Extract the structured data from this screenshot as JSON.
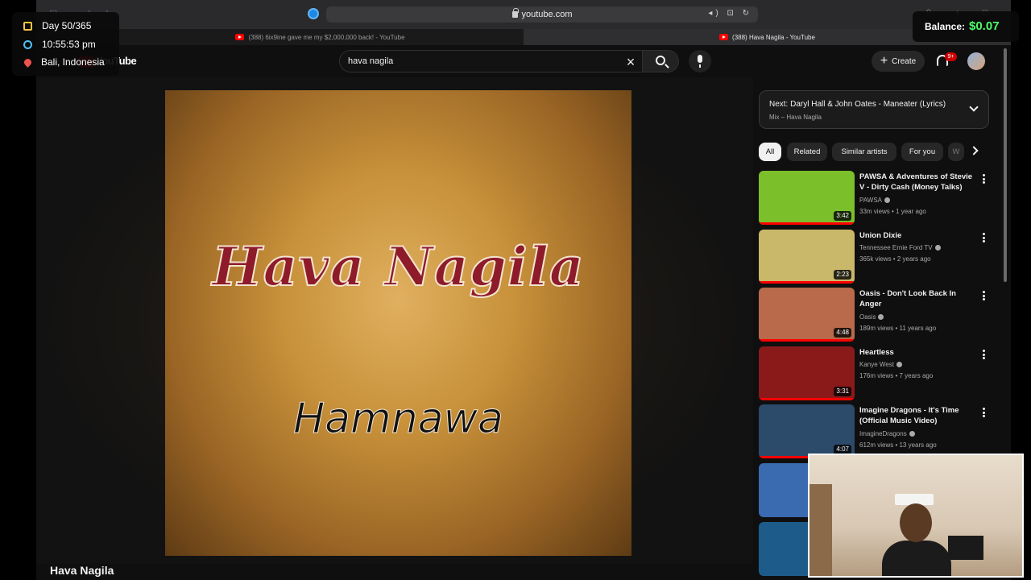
{
  "browser": {
    "url": "youtube.com",
    "tabs": [
      {
        "label": "(388) 6ix9ine gave me my $2,000,000 back! - YouTube"
      },
      {
        "label": "(388) Hava Nagila - YouTube"
      }
    ]
  },
  "overlay": {
    "day": "Day 50/365",
    "time": "10:55:53 pm",
    "location": "Bali, Indonesia",
    "balance_label": "Balance:",
    "balance_value": "$0.07"
  },
  "header": {
    "logo_text": "YouTube",
    "search_value": "hava nagila",
    "create_label": "Create",
    "notifications_badge": "9+"
  },
  "player": {
    "album_title": "Hava Nagila",
    "album_artist": "Hamnawa",
    "video_title": "Hava Nagila"
  },
  "sidebar": {
    "next_title": "Next: Daryl Hall & John Oates - Maneater (Lyrics)",
    "next_sub": "Mix – Hava Nagila",
    "chips": [
      "All",
      "Related",
      "Similar artists",
      "For you",
      "W"
    ],
    "recommendations": [
      {
        "title": "PAWSA & Adventures of Stevie V - Dirty Cash (Money Talks)",
        "channel": "PAWSA",
        "meta": "33m views • 1 year ago",
        "duration": "3:42",
        "thumb_color": "#7bbf2a"
      },
      {
        "title": "Union Dixie",
        "channel": "Tennessee Ernie Ford TV",
        "meta": "365k views • 2 years ago",
        "duration": "2:23",
        "thumb_color": "#c9b86a"
      },
      {
        "title": "Oasis - Don't Look Back In Anger",
        "channel": "Oasis",
        "meta": "189m views • 11 years ago",
        "duration": "4:48",
        "thumb_color": "#b86a4a"
      },
      {
        "title": "Heartless",
        "channel": "Kanye West",
        "meta": "176m views • 7 years ago",
        "duration": "3:31",
        "thumb_color": "#8a1a1a"
      },
      {
        "title": "Imagine Dragons - It's Time (Official Music Video)",
        "channel": "ImagineDragons",
        "meta": "612m views • 13 years ago",
        "duration": "4:07",
        "thumb_color": "#2c4a6a"
      }
    ]
  }
}
